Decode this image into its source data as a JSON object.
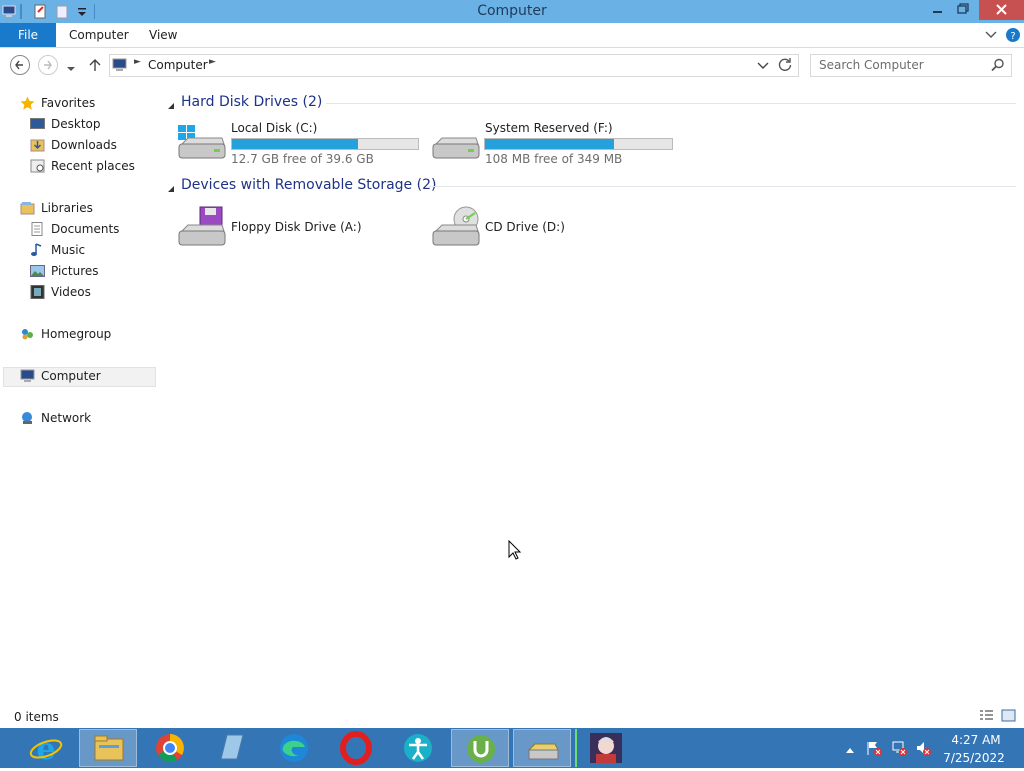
{
  "window": {
    "title": "Computer"
  },
  "ribbon": {
    "tabs": {
      "file": "File",
      "computer": "Computer",
      "view": "View"
    }
  },
  "address": {
    "path": "Computer",
    "search_placeholder": "Search Computer"
  },
  "nav": {
    "favorites": "Favorites",
    "desktop": "Desktop",
    "downloads": "Downloads",
    "recent": "Recent places",
    "libraries": "Libraries",
    "documents": "Documents",
    "music": "Music",
    "pictures": "Pictures",
    "videos": "Videos",
    "homegroup": "Homegroup",
    "computer": "Computer",
    "network": "Network"
  },
  "groups": {
    "hdd": {
      "title": "Hard Disk Drives (2)",
      "drives": [
        {
          "name": "Local Disk (C:)",
          "free": "12.7 GB free of 39.6 GB",
          "used_fraction": 0.68
        },
        {
          "name": "System Reserved (F:)",
          "free": "108 MB free of 349 MB",
          "used_fraction": 0.69
        }
      ]
    },
    "removable": {
      "title": "Devices with Removable Storage (2)",
      "drives": [
        {
          "name": "Floppy Disk Drive (A:)"
        },
        {
          "name": "CD Drive (D:)"
        }
      ]
    }
  },
  "status": {
    "items": "0 items"
  },
  "taskbar": {
    "apps": [
      "internet-explorer",
      "file-explorer",
      "chrome",
      "notepad",
      "edge",
      "opera",
      "accessibility-app",
      "utorrent",
      "disk-tool",
      "anime-app"
    ],
    "time": "4:27 AM",
    "date": "7/25/2022"
  },
  "colors": {
    "accent": "#1979ca",
    "titlebar": "#6ab1e6",
    "taskbar": "#3476b5",
    "progress": "#26a0da",
    "group_title": "#1e3287"
  }
}
